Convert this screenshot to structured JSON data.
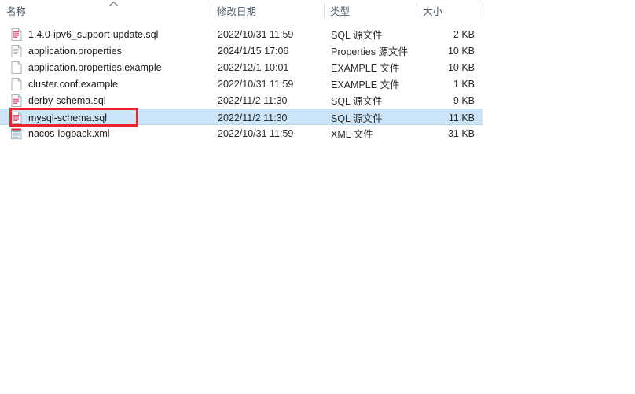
{
  "window": {
    "title": "File Explorer file list"
  },
  "columns": {
    "name": "名称",
    "date_modified": "修改日期",
    "type": "类型",
    "size": "大小",
    "sort_indicator": "sort-ascending-icon"
  },
  "files": [
    {
      "icon": "sql-file-icon",
      "name": "1.4.0-ipv6_support-update.sql",
      "date_modified": "2022/10/31 11:59",
      "type": "SQL 源文件",
      "size": "2 KB",
      "selected": false
    },
    {
      "icon": "properties-file-icon",
      "name": "application.properties",
      "date_modified": "2024/1/15 17:06",
      "type": "Properties 源文件",
      "size": "10 KB",
      "selected": false
    },
    {
      "icon": "blank-file-icon",
      "name": "application.properties.example",
      "date_modified": "2022/12/1 10:01",
      "type": "EXAMPLE 文件",
      "size": "10 KB",
      "selected": false
    },
    {
      "icon": "blank-file-icon",
      "name": "cluster.conf.example",
      "date_modified": "2022/10/31 11:59",
      "type": "EXAMPLE 文件",
      "size": "1 KB",
      "selected": false
    },
    {
      "icon": "sql-file-icon",
      "name": "derby-schema.sql",
      "date_modified": "2022/11/2 11:30",
      "type": "SQL 源文件",
      "size": "9 KB",
      "selected": false
    },
    {
      "icon": "sql-file-icon",
      "name": "mysql-schema.sql",
      "date_modified": "2022/11/2 11:30",
      "type": "SQL 源文件",
      "size": "11 KB",
      "selected": true
    },
    {
      "icon": "xml-file-icon",
      "name": "nacos-logback.xml",
      "date_modified": "2022/10/31 11:59",
      "type": "XML 文件",
      "size": "31 KB",
      "selected": false
    }
  ],
  "annotation": {
    "shape": "rectangle",
    "color": "#e8252a",
    "target": "mysql-schema.sql"
  },
  "colors": {
    "selection_background": "#cce4f7",
    "selection_border": "#b6d9f2",
    "header_text": "#4a5a6a",
    "annotation": "#e8252a",
    "sql_icon_accent": "#e8447e",
    "xml_icon_accent": "#7fb3c8"
  }
}
